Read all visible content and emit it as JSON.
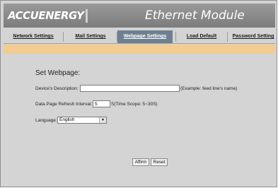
{
  "header": {
    "logo_text": "ACCUENERGY",
    "module_title": "Ethernet Module"
  },
  "tabs": [
    {
      "label": "Network Settings",
      "active": false
    },
    {
      "label": "Mail Settings",
      "active": false
    },
    {
      "label": "Webpage Settings",
      "active": true
    },
    {
      "label": "Load Default",
      "active": false
    },
    {
      "label": "Password Setting",
      "active": false
    }
  ],
  "form": {
    "title": "Set Webpage:",
    "description": {
      "label": "Device's Description:",
      "value": "",
      "hint": "(Example: feed line's name)"
    },
    "refresh": {
      "label": "Data Page Refresh Interval:",
      "value": "5",
      "hint": "S(Time Scope: 5~30S)"
    },
    "language": {
      "label": "Language:",
      "selected": "English"
    }
  },
  "buttons": {
    "affirm": "Affirm",
    "reset": "Reset"
  },
  "colors": {
    "active_tab": "#6e8090",
    "orange_bar": "#f2cc90",
    "background": "#d4d4d4"
  }
}
